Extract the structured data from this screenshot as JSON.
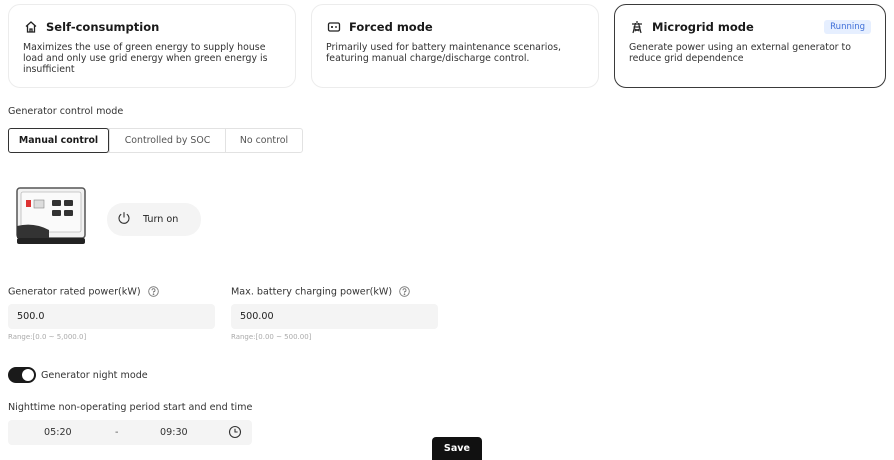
{
  "modes": [
    {
      "icon": "home-icon",
      "title": "Self-consumption",
      "description": "Maximizes the use of green energy to supply house load and only use grid energy when green energy is insufficient",
      "active": false
    },
    {
      "icon": "battery-icon",
      "title": "Forced mode",
      "description": "Primarily used for battery maintenance scenarios, featuring manual charge/discharge control.",
      "active": false
    },
    {
      "icon": "power-tower-icon",
      "title": "Microgrid mode",
      "description": "Generate power using an external generator to reduce grid dependence",
      "active": true,
      "badge": "Running"
    }
  ],
  "generator_control": {
    "label": "Generator control mode",
    "options": [
      "Manual control",
      "Controlled by SOC",
      "No control"
    ],
    "selected": "Manual control"
  },
  "generator": {
    "image_icon": "generator-icon",
    "turn_on_label": "Turn on"
  },
  "rated_power": {
    "label": "Generator rated power(kW)",
    "value": "500.0",
    "range": "Range:[0.0 ~ 5,000.0]"
  },
  "max_charging": {
    "label": "Max. battery charging power(kW)",
    "value": "500.00",
    "range": "Range:[0.00 ~ 500.00]"
  },
  "night_mode": {
    "label": "Generator night mode",
    "enabled": true
  },
  "night_period": {
    "label": "Nighttime non-operating period start and end time",
    "start": "05:20",
    "separator": "-",
    "end": "09:30"
  },
  "save_label": "Save",
  "colors": {
    "accent_dark": "#111111",
    "badge_bg": "#e6efff",
    "badge_text": "#3f6fd8",
    "field_bg": "#f4f4f4"
  }
}
